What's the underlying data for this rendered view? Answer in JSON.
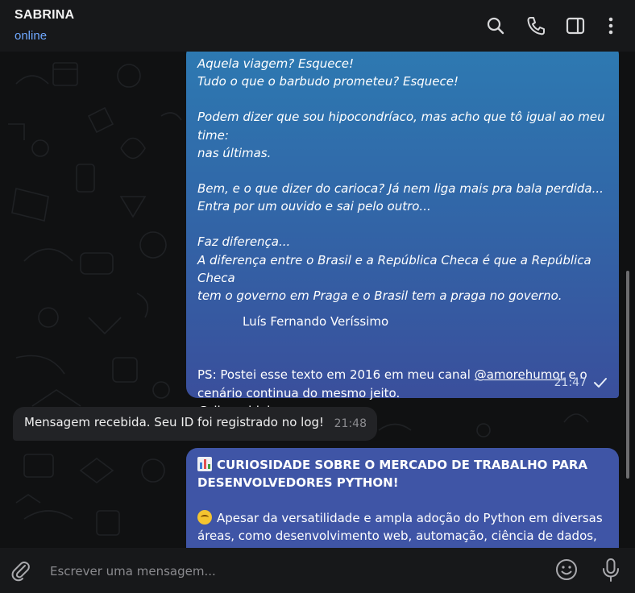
{
  "header": {
    "name": "SABRINA",
    "status": "online",
    "icons": [
      "search-icon",
      "phone-icon",
      "sidebar-toggle-icon",
      "more-vertical-icon"
    ]
  },
  "messages": [
    {
      "id": "quote",
      "lines": [
        "Aquela viagem? Esquece!",
        "Tudo o que o barbudo prometeu? Esquece!",
        "",
        "Podem dizer que sou hipocondríaco, mas acho que tô igual ao meu time:",
        "nas últimas.",
        "",
        "Bem, e o que dizer do carioca? Já nem liga mais pra bala perdida...",
        "Entra por um ouvido e sai pelo outro...",
        "",
        "Faz diferença...",
        "A diferença entre o Brasil e a República Checa é que a República Checa",
        "tem o governo em Praga e o Brasil tem a praga no governo."
      ],
      "author": "Luís Fernando Veríssimo",
      "ps_before": "PS: Postei esse texto em 2016 em meu canal ",
      "ps_link": "@amorehumor",
      "ps_after": " e o",
      "ps_line2": "cenário continua do mesmo jeito.",
      "ps_link2": "@dicaseideias",
      "time": "21:47"
    },
    {
      "id": "received",
      "text": "Mensagem recebida. Seu ID foi registrado no log!",
      "time": "21:48"
    },
    {
      "id": "curiosity",
      "title_line1": "CURIOSIDADE SOBRE O MERCADO DE TRABALHO PARA",
      "title_line2": "DESENVOLVEDORES PYTHON!",
      "body_line1": "Apesar da versatilidade e ampla adoção do Python em diversas",
      "body_line2": "áreas, como desenvolvimento web, automação, ciência de dados, e"
    }
  ],
  "composer": {
    "placeholder": "Escrever uma mensagem..."
  },
  "colors": {
    "accent_status": "#6fa8ff",
    "bubble_out_top": "#2d7ab2",
    "bubble_out_bottom": "#3a4f9c",
    "bubble_in": "#222326"
  }
}
